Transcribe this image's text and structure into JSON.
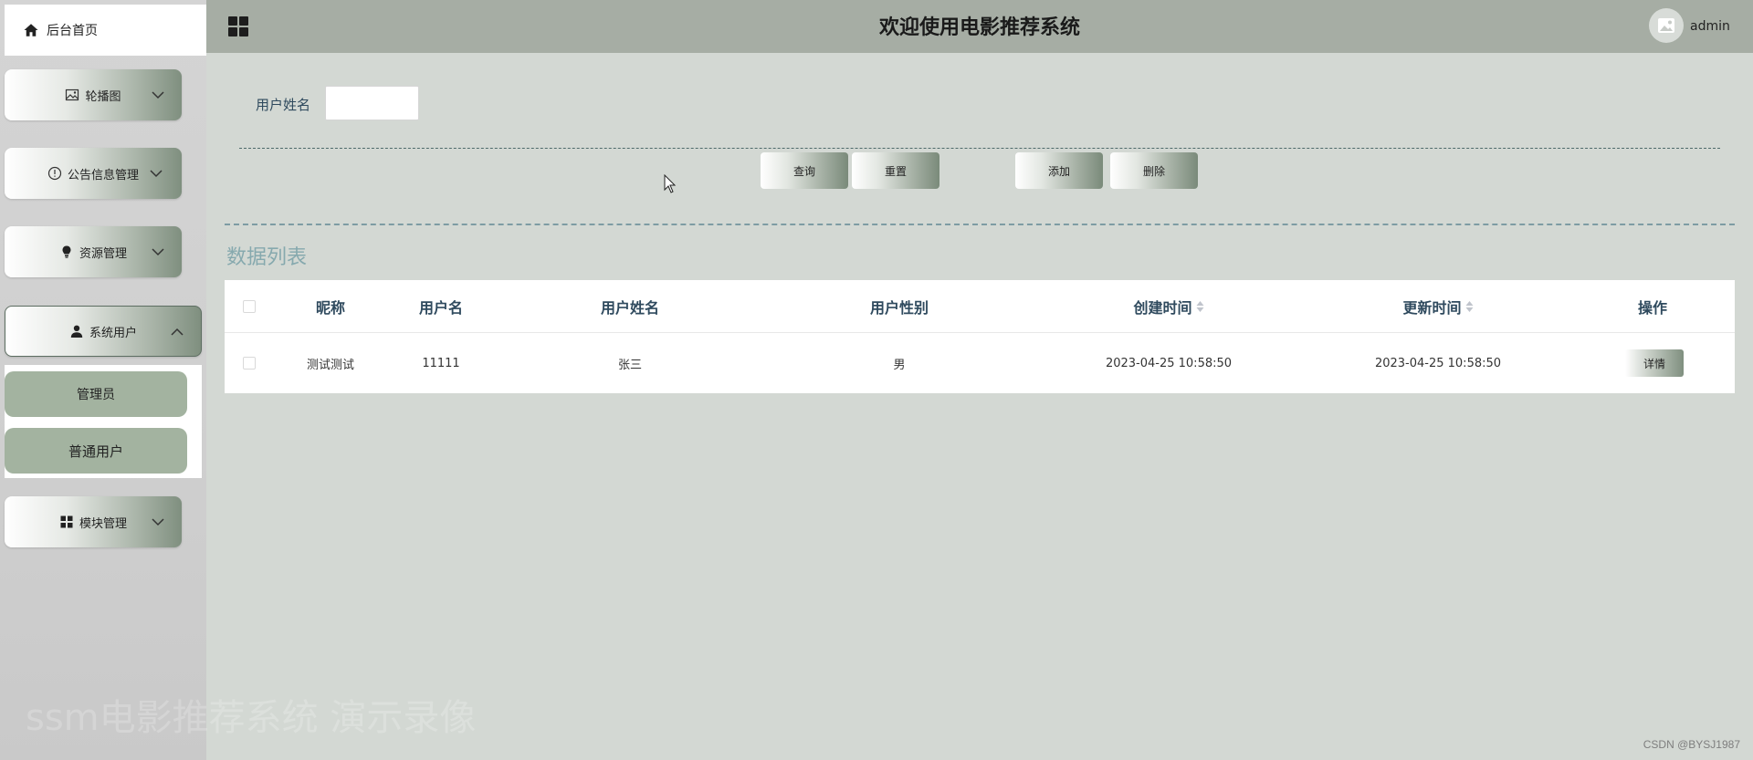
{
  "sidebar": {
    "home_label": "后台首页",
    "menus": [
      {
        "label": "轮播图",
        "icon": "image-icon"
      },
      {
        "label": "公告信息管理",
        "icon": "info-icon"
      },
      {
        "label": "资源管理",
        "icon": "bulb-icon"
      },
      {
        "label": "系统用户",
        "icon": "user-icon"
      },
      {
        "label": "模块管理",
        "icon": "grid-icon"
      }
    ],
    "submenu": [
      {
        "label": "管理员"
      },
      {
        "label": "普通用户"
      }
    ]
  },
  "header": {
    "title": "欢迎使用电影推荐系统",
    "username": "admin"
  },
  "search": {
    "label": "用户姓名",
    "value": ""
  },
  "actions": {
    "query": "查询",
    "reset": "重置",
    "add": "添加",
    "delete": "删除"
  },
  "list_title": "数据列表",
  "table": {
    "columns": [
      "昵称",
      "用户名",
      "用户姓名",
      "用户性别",
      "创建时间",
      "更新时间",
      "操作"
    ],
    "rows": [
      {
        "nickname": "测试测试",
        "username": "11111",
        "realname": "张三",
        "gender": "男",
        "created": "2023-04-25 10:58:50",
        "updated": "2023-04-25 10:58:50",
        "action": "详情"
      }
    ]
  },
  "watermark": "ssm电影推荐系统 演示录像",
  "credit": "CSDN @BYSJ1987",
  "colors": {
    "header_bg": "#a6ada4",
    "content_bg": "#d3d8d3",
    "submenu_bg": "#a3b3a0",
    "table_header_text": "#2f4a5e",
    "list_title": "#86a9ae"
  }
}
